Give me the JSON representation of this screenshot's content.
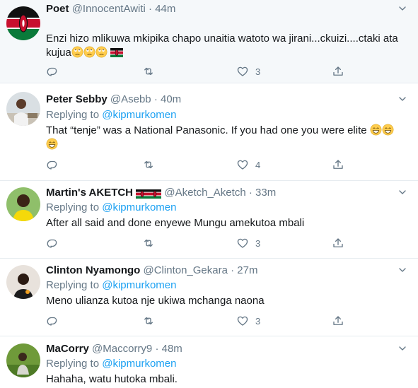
{
  "tweets": [
    {
      "name": "Poet",
      "handle": "@InnocentAwiti",
      "time": "44m",
      "replying_prefix": "",
      "mention": "",
      "text": "Enzi hizo mlikuwa mkipika chapo unaitia watoto wa jirani...ckuizi....ctaki ata kujua",
      "likes": "3"
    },
    {
      "name": "Peter Sebby",
      "handle": "@Asebb",
      "time": "40m",
      "replying_prefix": "Replying to ",
      "mention": "@kipmurkomen",
      "text": "That “tenje” was a National Panasonic. If you had one you were elite",
      "likes": "4"
    },
    {
      "name": "Martin's AKETCH",
      "handle": "@Aketch_Aketch",
      "time": "33m",
      "replying_prefix": "Replying to ",
      "mention": "@kipmurkomen",
      "text": "After all said and done enyewe Mungu amekutoa mbali",
      "likes": "3"
    },
    {
      "name": "Clinton Nyamongo",
      "handle": "@Clinton_Gekara",
      "time": "27m",
      "replying_prefix": "Replying to ",
      "mention": "@kipmurkomen",
      "text": "Meno ulianza kutoa nje ukiwa mchanga naona",
      "likes": "3"
    },
    {
      "name": "MaCorry",
      "handle": "@Maccorry9",
      "time": "48m",
      "replying_prefix": "Replying to ",
      "mention": "@kipmurkomen",
      "text": "Hahaha, watu hutoka mbali.",
      "likes": ""
    }
  ],
  "separator": "·",
  "icons": {
    "reply": "reply-icon",
    "retweet": "retweet-icon",
    "like": "heart-icon",
    "share": "share-icon",
    "menu": "chevron-down-icon"
  },
  "colors": {
    "mention": "#1da1f2",
    "muted": "#657786",
    "highlight_bg": "#f5f8fa"
  }
}
